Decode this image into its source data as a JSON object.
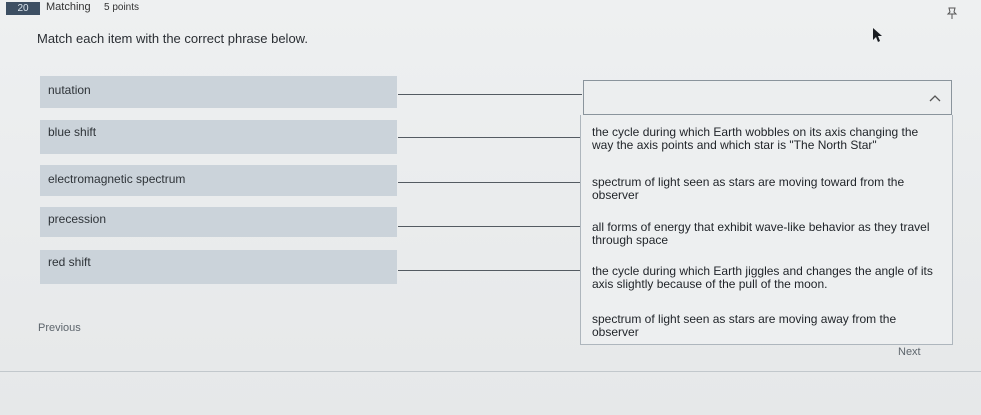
{
  "header": {
    "question_number": "20",
    "question_type": "Matching",
    "points": "5 points",
    "pin_icon": "pin-icon"
  },
  "prompt": "Match each item with the correct phrase below.",
  "items": [
    {
      "label": "nutation"
    },
    {
      "label": "blue shift"
    },
    {
      "label": "electromagnetic spectrum"
    },
    {
      "label": "precession"
    },
    {
      "label": "red shift"
    }
  ],
  "dropdown": {
    "value": "",
    "icon": "chevron-up-icon"
  },
  "options": [
    {
      "text": "the cycle during which Earth wobbles on its axis changing the way the axis points and which star is \"The North Star\""
    },
    {
      "text": "spectrum of light seen as stars are moving toward from the observer"
    },
    {
      "text": "all forms of energy that exhibit wave-like behavior as they travel through space"
    },
    {
      "text": "the cycle during which Earth jiggles and changes the angle of its axis slightly because of the pull of the moon."
    },
    {
      "text": "spectrum of light seen as stars are moving away from the observer"
    }
  ],
  "nav": {
    "previous": "Previous",
    "next": "Next"
  }
}
